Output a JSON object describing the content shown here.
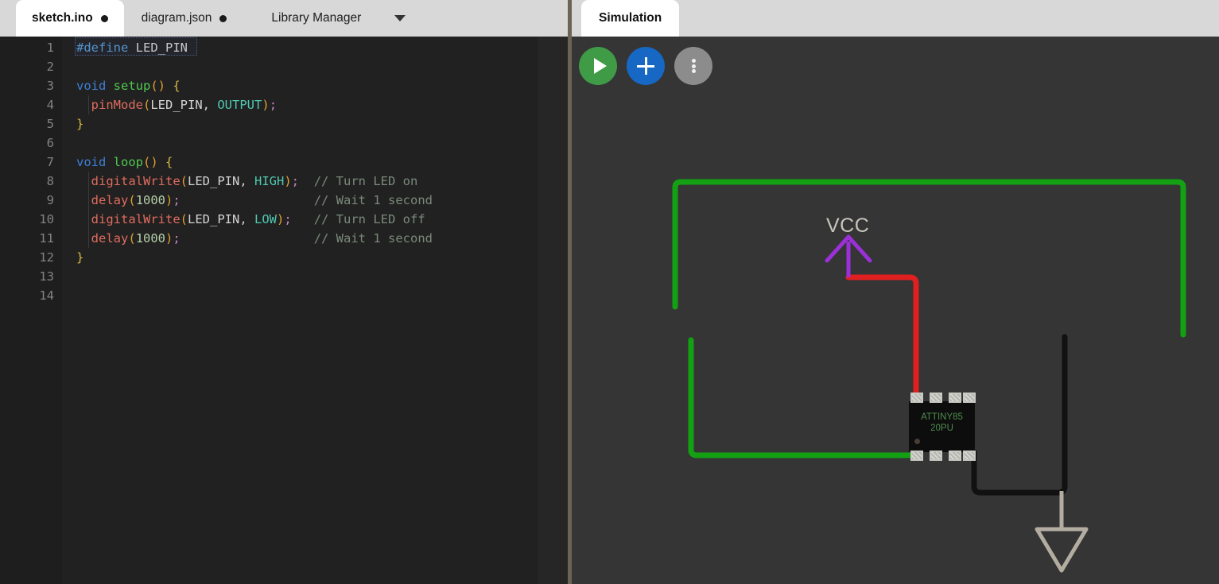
{
  "app": {
    "accent_blue": "#1668c4",
    "accent_green": "#3f9b46",
    "accent_gray": "#8c8c8c",
    "editor_bg": "#1e1e1e",
    "canvas_bg": "#353535",
    "tabbar_bg": "#d8d8d8"
  },
  "left_panel": {
    "tabs": [
      {
        "label": "sketch.ino",
        "dirty": "●",
        "active": true
      },
      {
        "label": "diagram.json",
        "dirty": "●",
        "active": false
      },
      {
        "label": "Library Manager",
        "dirty": "",
        "active": false
      }
    ],
    "dropdown_icon": "chevron-down-icon"
  },
  "editor": {
    "language": "arduino-cpp",
    "selection_text": "#define LED_PIN",
    "lines": [
      {
        "num": "1",
        "text": "#define LED_PIN"
      },
      {
        "num": "2",
        "text": ""
      },
      {
        "num": "3",
        "text": "void setup() {"
      },
      {
        "num": "4",
        "text": "  pinMode(LED_PIN, OUTPUT);"
      },
      {
        "num": "5",
        "text": "}"
      },
      {
        "num": "6",
        "text": ""
      },
      {
        "num": "7",
        "text": "void loop() {"
      },
      {
        "num": "8",
        "text": "  digitalWrite(LED_PIN, HIGH);  // Turn LED on"
      },
      {
        "num": "9",
        "text": "  delay(1000);                  // Wait 1 second"
      },
      {
        "num": "10",
        "text": "  digitalWrite(LED_PIN, LOW);   // Turn LED off"
      },
      {
        "num": "11",
        "text": "  delay(1000);                  // Wait 1 second"
      },
      {
        "num": "12",
        "text": "}"
      },
      {
        "num": "13",
        "text": ""
      },
      {
        "num": "14",
        "text": ""
      }
    ],
    "tokens": {
      "l1": [
        [
          "#define",
          "t-pre"
        ],
        [
          " ",
          "t-punc"
        ],
        [
          "LED_PIN",
          "t-ident"
        ]
      ],
      "l3": [
        [
          "void",
          "t-kw"
        ],
        [
          " ",
          "t-punc"
        ],
        [
          "setup",
          "t-fn"
        ],
        [
          "()",
          "t-paren"
        ],
        [
          " ",
          "t-punc"
        ],
        [
          "{",
          "t-brace"
        ]
      ],
      "l4": [
        [
          "  ",
          "t-punc"
        ],
        [
          "pinMode",
          "t-call"
        ],
        [
          "(",
          "t-paren"
        ],
        [
          "LED_PIN",
          "t-ident"
        ],
        [
          ", ",
          "t-punc"
        ],
        [
          "OUTPUT",
          "t-const"
        ],
        [
          ")",
          "t-paren"
        ],
        [
          ";",
          "t-semi"
        ]
      ],
      "l5": [
        [
          "}",
          "t-brace"
        ]
      ],
      "l7": [
        [
          "void",
          "t-kw"
        ],
        [
          " ",
          "t-punc"
        ],
        [
          "loop",
          "t-fn"
        ],
        [
          "()",
          "t-paren"
        ],
        [
          " ",
          "t-punc"
        ],
        [
          "{",
          "t-brace"
        ]
      ],
      "l8": [
        [
          "  ",
          "t-punc"
        ],
        [
          "digitalWrite",
          "t-call"
        ],
        [
          "(",
          "t-paren"
        ],
        [
          "LED_PIN",
          "t-ident"
        ],
        [
          ", ",
          "t-punc"
        ],
        [
          "HIGH",
          "t-const"
        ],
        [
          ")",
          "t-paren"
        ],
        [
          ";",
          "t-semi"
        ],
        [
          "  ",
          "t-punc"
        ],
        [
          "// Turn LED on",
          "t-cmt"
        ]
      ],
      "l9": [
        [
          "  ",
          "t-punc"
        ],
        [
          "delay",
          "t-call"
        ],
        [
          "(",
          "t-paren"
        ],
        [
          "1000",
          "t-num"
        ],
        [
          ")",
          "t-paren"
        ],
        [
          ";",
          "t-semi"
        ],
        [
          "                  ",
          "t-punc"
        ],
        [
          "// Wait 1 second",
          "t-cmt"
        ]
      ],
      "l10": [
        [
          "  ",
          "t-punc"
        ],
        [
          "digitalWrite",
          "t-call"
        ],
        [
          "(",
          "t-paren"
        ],
        [
          "LED_PIN",
          "t-ident"
        ],
        [
          ", ",
          "t-punc"
        ],
        [
          "LOW",
          "t-const"
        ],
        [
          ")",
          "t-paren"
        ],
        [
          ";",
          "t-semi"
        ],
        [
          "   ",
          "t-punc"
        ],
        [
          "// Turn LED off",
          "t-cmt"
        ]
      ],
      "l11": [
        [
          "  ",
          "t-punc"
        ],
        [
          "delay",
          "t-call"
        ],
        [
          "(",
          "t-paren"
        ],
        [
          "1000",
          "t-num"
        ],
        [
          ")",
          "t-paren"
        ],
        [
          ";",
          "t-semi"
        ],
        [
          "                  ",
          "t-punc"
        ],
        [
          "// Wait 1 second",
          "t-cmt"
        ]
      ],
      "l12": [
        [
          "}",
          "t-brace"
        ]
      ]
    }
  },
  "right_panel": {
    "tab_label": "Simulation",
    "toolbar": [
      {
        "name": "play-button",
        "icon": "play-icon",
        "color": "#3f9b46",
        "label": ""
      },
      {
        "name": "add-button",
        "icon": "plus-icon",
        "color": "#1668c4",
        "label": ""
      },
      {
        "name": "more-button",
        "icon": "kebab-menu-icon",
        "color": "#8c8c8c",
        "label": ""
      }
    ]
  },
  "circuit": {
    "labels": {
      "vcc": "VCC"
    },
    "chip": {
      "line1": "ATTINY85",
      "line2": "20PU",
      "pin_count": 8,
      "text_color": "#4d8c4d"
    },
    "led": {
      "color": "red",
      "body_color": "#e8231f"
    },
    "resistor": {
      "bands": [
        "brown",
        "black",
        "red",
        "gold"
      ],
      "body_color": "#ded8c8"
    },
    "ground": {
      "symbol": "ground-triangle",
      "color": "#b3aca1"
    },
    "wires": [
      {
        "name": "led-anode-to-resistor",
        "color": "#13a113",
        "net": "green"
      },
      {
        "name": "led-cathode-to-chip-pin",
        "color": "#13a113",
        "net": "green"
      },
      {
        "name": "vcc-to-chip",
        "color": "#e02020",
        "net": "red"
      },
      {
        "name": "chip-gnd-to-resistor",
        "color": "#111111",
        "net": "black"
      }
    ]
  }
}
